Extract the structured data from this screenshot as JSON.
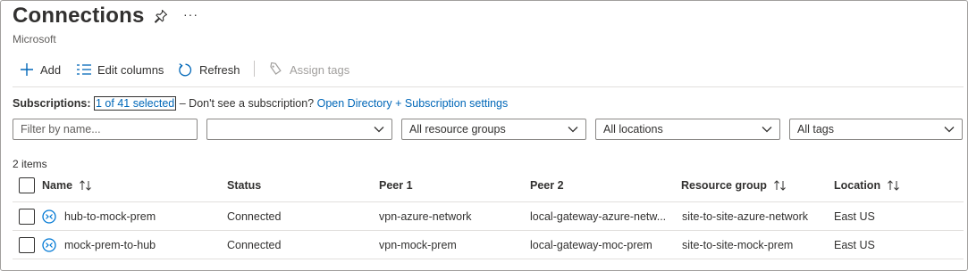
{
  "header": {
    "title": "Connections",
    "subtitle": "Microsoft",
    "more_label": "···",
    "pin_icon": "pin-icon"
  },
  "toolbar": {
    "add_label": "Add",
    "edit_columns_label": "Edit columns",
    "refresh_label": "Refresh",
    "assign_tags_label": "Assign tags"
  },
  "subscriptions": {
    "label": "Subscriptions:",
    "selected": "1 of 41 selected",
    "hint": " – Don't see a subscription? ",
    "settings_link": "Open Directory + Subscription settings"
  },
  "filters": {
    "search_placeholder": "Filter by name...",
    "subscription_value": "",
    "resource_groups": "All resource groups",
    "locations": "All locations",
    "tags": "All tags"
  },
  "list": {
    "count": "2 items",
    "columns": {
      "name": "Name",
      "status": "Status",
      "peer1": "Peer 1",
      "peer2": "Peer 2",
      "resource_group": "Resource group",
      "location": "Location"
    },
    "rows": [
      {
        "name": "hub-to-mock-prem",
        "status": "Connected",
        "peer1": "vpn-azure-network",
        "peer2": "local-gateway-azure-netw...",
        "resource_group": "site-to-site-azure-network",
        "location": "East US"
      },
      {
        "name": "mock-prem-to-hub",
        "status": "Connected",
        "peer1": "vpn-mock-prem",
        "peer2": "local-gateway-moc-prem",
        "resource_group": "site-to-site-mock-prem",
        "location": "East US"
      }
    ]
  },
  "colors": {
    "link": "#0067b8",
    "text": "#323130",
    "border": "#8a8886"
  }
}
